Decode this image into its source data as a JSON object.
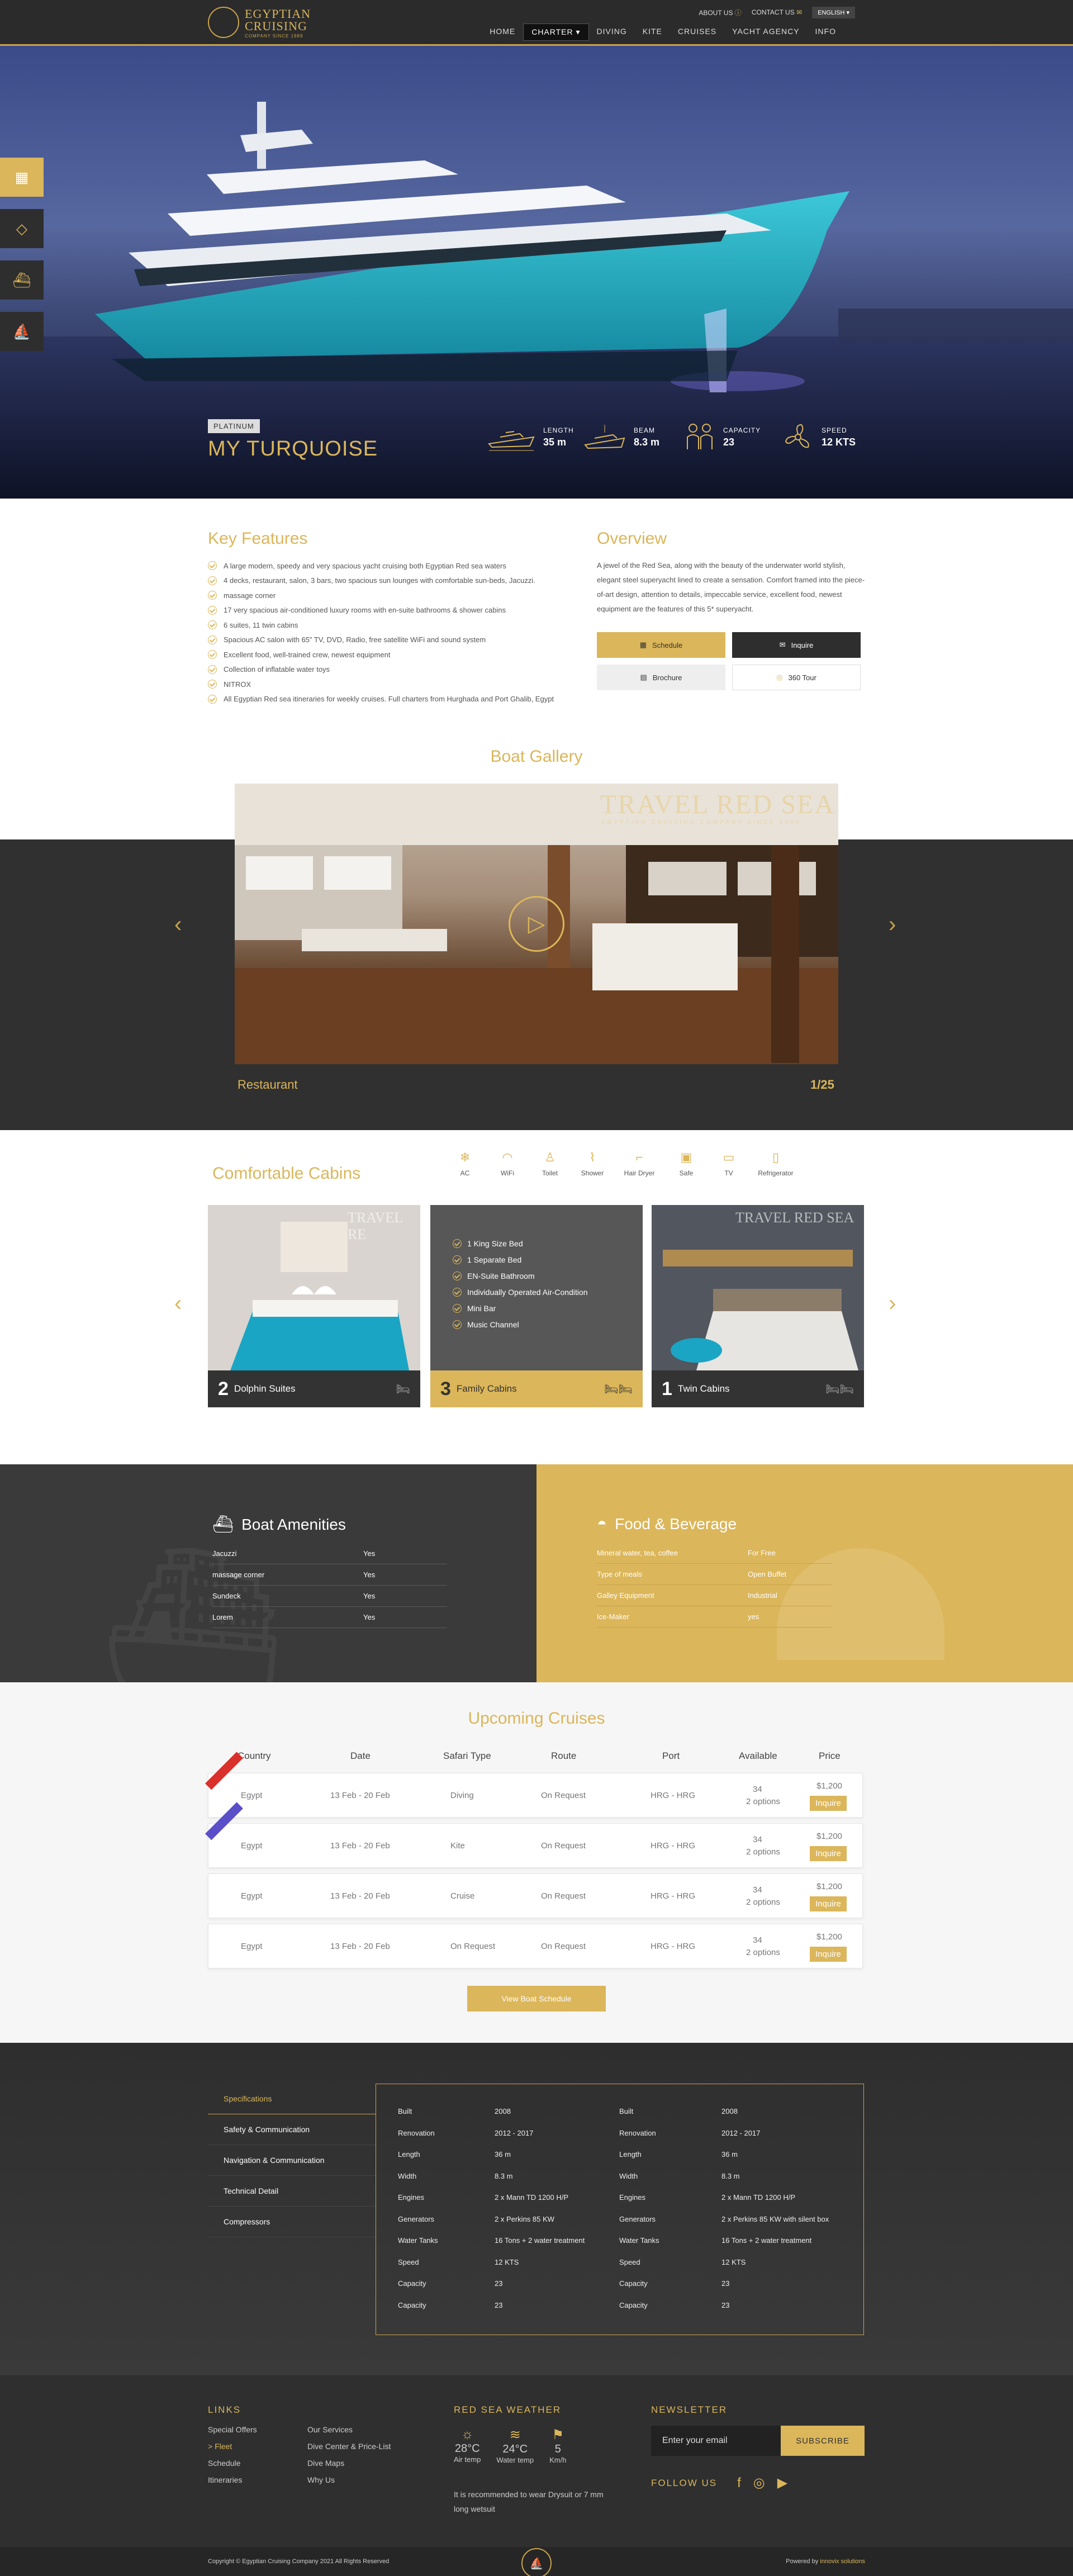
{
  "header": {
    "logo_line1": "EGYPTIAN",
    "logo_line2": "CRUISING",
    "logo_tag": "COMPANY SINCE 1989",
    "about": "ABOUT US",
    "contact": "CONTACT US",
    "lang": "ENGLISH",
    "nav": [
      "HOME",
      "CHARTER",
      "DIVING",
      "KITE",
      "CRUISES",
      "YACHT AGENCY",
      "INFO"
    ]
  },
  "hero": {
    "badge": "PLATINUM",
    "title": "MY TURQUOISE",
    "specs": [
      {
        "label": "LENGTH",
        "value": "35 m"
      },
      {
        "label": "BEAM",
        "value": "8.3 m"
      },
      {
        "label": "CAPACITY",
        "value": "23"
      },
      {
        "label": "SPEED",
        "value": "12 KTS"
      }
    ]
  },
  "features": {
    "title": "Key Features",
    "items": [
      "A large modern, speedy and very spacious yacht cruising both Egyptian Red sea waters",
      "4 decks, restaurant, salon, 3 bars, two spacious sun lounges with comfortable sun-beds, Jacuzzi.",
      "massage corner",
      "17 very spacious air-conditioned luxury rooms with en-suite bathrooms & shower cabins",
      "6 suites, 11 twin cabins",
      "Spacious AC salon with 65\" TV, DVD, Radio, free satellite WiFi and sound system",
      "Excellent food, well-trained crew, newest equipment",
      "Collection of inflatable water toys",
      "NITROX",
      "All Egyptian Red sea itineraries for weekly cruises. Full charters from Hurghada and Port Ghalib, Egypt"
    ]
  },
  "overview": {
    "title": "Overview",
    "text": "A jewel of the Red Sea, along with the beauty of the underwater world stylish, elegant steel superyacht lined to create a sensation. Comfort framed into the piece-of-art design, attention to details, impeccable service, excellent food, newest equipment are the features of this 5* superyacht.",
    "buttons": [
      "Schedule",
      "Inquire",
      "Brochure",
      "360 Tour"
    ]
  },
  "gallery": {
    "title": "Boat Gallery",
    "caption": "Restaurant",
    "counter": "1/25",
    "watermark": "TRAVEL RED SEA",
    "watermark_sub": "EGYPTIAN CRUISING COMPANY SINCE 1989"
  },
  "cabins": {
    "title": "Comfortable Cabins",
    "amenities": [
      "AC",
      "WiFi",
      "Toilet",
      "Shower",
      "Hair Dryer",
      "Safe",
      "TV",
      "Refrigerator"
    ],
    "cards": [
      {
        "count": "2",
        "name": "Dolphin Suites"
      },
      {
        "count": "3",
        "name": "Family Cabins"
      },
      {
        "count": "1",
        "name": "Twin Cabins"
      }
    ],
    "family_features": [
      "1 King Size Bed",
      "1 Separate Bed",
      "EN-Suite Bathroom",
      "Individually Operated Air-Condition",
      "Mini Bar",
      "Music Channel"
    ],
    "photo_watermark": "TRAVEL RE"
  },
  "boat_amenities": {
    "title": "Boat Amenities",
    "rows": [
      {
        "k": "Jacuzzi",
        "v": "Yes"
      },
      {
        "k": "massage corner",
        "v": "Yes"
      },
      {
        "k": "Sundeck",
        "v": "Yes"
      },
      {
        "k": "Lorem",
        "v": "Yes"
      }
    ]
  },
  "food": {
    "title": "Food & Beverage",
    "rows": [
      {
        "k": "Mineral water, tea, coffee",
        "v": "For Free"
      },
      {
        "k": "Type of meals",
        "v": "Open Buffet"
      },
      {
        "k": "Galley Equipment",
        "v": "Industrial"
      },
      {
        "k": "Ice-Maker",
        "v": "yes"
      }
    ]
  },
  "cruises": {
    "title": "Upcoming Cruises",
    "headers": [
      "Country",
      "Date",
      "Safari Type",
      "Route",
      "Port",
      "Available",
      "Price"
    ],
    "rows": [
      {
        "country": "Egypt",
        "date": "13 Feb - 20 Feb",
        "type": "Diving",
        "route": "On Request",
        "port": "HRG - HRG",
        "avail": "34",
        "opts": "2 options",
        "price": "$1,200",
        "book": "Inquire",
        "ribbon": "red"
      },
      {
        "country": "Egypt",
        "date": "13 Feb - 20 Feb",
        "type": "Kite",
        "route": "On Request",
        "port": "HRG - HRG",
        "avail": "34",
        "opts": "2 options",
        "price": "$1,200",
        "book": "Inquire",
        "ribbon": "blue"
      },
      {
        "country": "Egypt",
        "date": "13 Feb - 20 Feb",
        "type": "Cruise",
        "route": "On Request",
        "port": "HRG - HRG",
        "avail": "34",
        "opts": "2 options",
        "price": "$1,200",
        "book": "Inquire",
        "ribbon": ""
      },
      {
        "country": "Egypt",
        "date": "13 Feb - 20 Feb",
        "type": "On Request",
        "route": "On Request",
        "port": "HRG - HRG",
        "avail": "34",
        "opts": "2 options",
        "price": "$1,200",
        "book": "Inquire",
        "ribbon": ""
      }
    ],
    "view_all": "View Boat Schedule"
  },
  "specs": {
    "tabs": [
      "Specifications",
      "Safety & Communication",
      "Navigation & Communication",
      "Technical Detail",
      "Compressors"
    ],
    "rows": [
      {
        "k": "Built",
        "v": "2008"
      },
      {
        "k": "Renovation",
        "v": "2012 - 2017"
      },
      {
        "k": "Length",
        "v": "36 m"
      },
      {
        "k": "Width",
        "v": "8.3 m"
      },
      {
        "k": "Engines",
        "v": "2 x Mann TD 1200 H/P"
      },
      {
        "k": "Generators",
        "v": "2 x Perkins 85 KW"
      },
      {
        "k": "Water Tanks",
        "v": "16 Tons + 2 water treatment"
      },
      {
        "k": "Speed",
        "v": "12 KTS"
      },
      {
        "k": "Capacity",
        "v": "23"
      },
      {
        "k": "Capacity",
        "v": "23"
      }
    ],
    "rows2": [
      {
        "k": "Built",
        "v": "2008"
      },
      {
        "k": "Renovation",
        "v": "2012 - 2017"
      },
      {
        "k": "Length",
        "v": "36 m"
      },
      {
        "k": "Width",
        "v": "8.3 m"
      },
      {
        "k": "Engines",
        "v": "2 x Mann TD 1200 H/P"
      },
      {
        "k": "Generators",
        "v": "2 x Perkins 85 KW with silent box"
      },
      {
        "k": "Water Tanks",
        "v": "16 Tons + 2 water treatment"
      },
      {
        "k": "Speed",
        "v": "12 KTS"
      },
      {
        "k": "Capacity",
        "v": "23"
      },
      {
        "k": "Capacity",
        "v": "23"
      }
    ]
  },
  "footer": {
    "links_title": "LINKS",
    "links_col1": [
      "Special Offers",
      "> Fleet",
      "Schedule",
      "Itineraries"
    ],
    "links_col2": [
      "Our Services",
      "Dive Center & Price-List",
      "Dive Maps",
      "Why Us"
    ],
    "weather_title": "RED SEA WEATHER",
    "weather": [
      {
        "val": "28°C",
        "lbl": "Air temp"
      },
      {
        "val": "24°C",
        "lbl": "Water temp"
      },
      {
        "val": "5",
        "lbl": "Km/h"
      }
    ],
    "weather_note": "It is recommended to wear Drysuit or 7 mm long wetsuit",
    "newsletter_title": "NEWSLETTER",
    "email_placeholder": "Enter your email",
    "subscribe": "SUBSCRIBE",
    "follow": "FOLLOW US",
    "copyright": "Copyright © Egyptian Cruising Company 2021 All Rights Reserved",
    "powered_prefix": "Powered by",
    "powered_by": "innovix solutions"
  },
  "colors": {
    "gold": "#dbb65a",
    "dark": "#2b2b2b",
    "band": "#303030"
  }
}
